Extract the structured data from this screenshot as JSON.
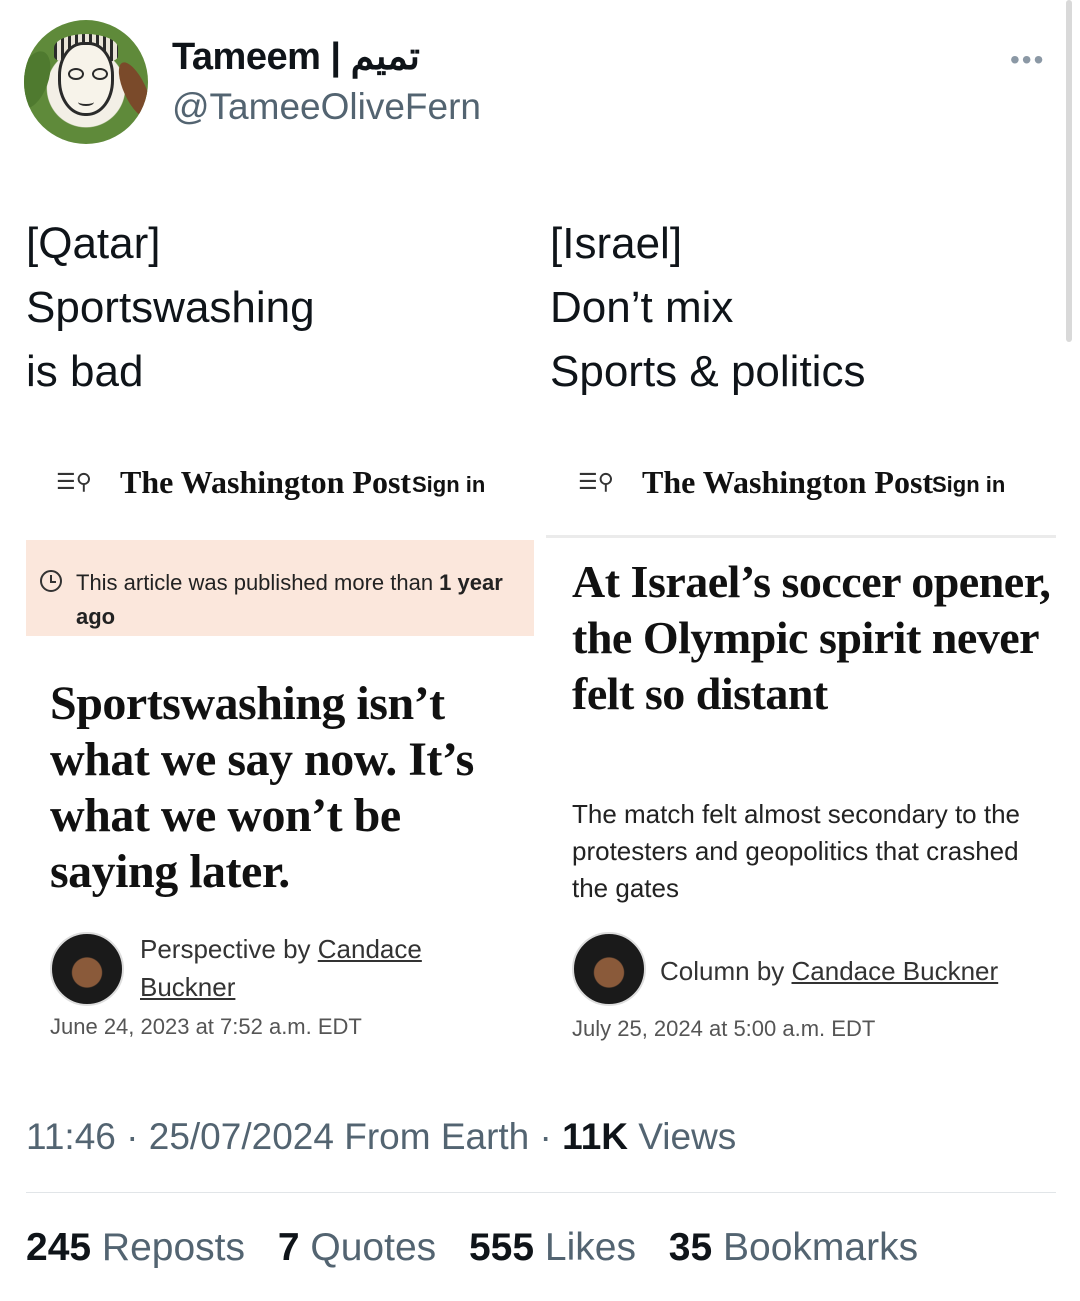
{
  "header": {
    "display_name": "Tameem | تميم",
    "handle": "@TameeOliveFern",
    "more_label": "•••"
  },
  "tweet": {
    "left_lines": [
      "[Qatar]",
      "Sportswashing",
      "is bad"
    ],
    "right_lines": [
      "[Israel]",
      "Don’t mix",
      "Sports & politics"
    ]
  },
  "left_article": {
    "menu_icon": "menu-search-icon",
    "masthead": "The Washington Post",
    "signin": "Sign in",
    "notice_text": "This article was published more than ",
    "notice_bold": "1 year ago",
    "headline": "Sportswashing isn’t what we say now. It’s what we won’t be saying later.",
    "byline_prefix": "Perspective by ",
    "author": "Candace Buckner",
    "date": "June 24, 2023 at 7:52 a.m. EDT"
  },
  "right_article": {
    "menu_icon": "menu-search-icon",
    "masthead": "The Washington Post",
    "signin": "Sign in",
    "headline": "At Israel’s soccer opener, the Olympic spirit never felt so distant",
    "dek": "The match felt almost secondary to the protesters and geopolitics that crashed the gates",
    "byline_prefix": "Column by ",
    "author": "Candace Buckner",
    "date": "July 25, 2024 at 5:00 a.m. EDT"
  },
  "meta": {
    "time": "11:46",
    "date": "25/07/2024",
    "source": "From Earth",
    "views_count": "11K",
    "views_label": "Views"
  },
  "stats": {
    "reposts_count": "245",
    "reposts_label": "Reposts",
    "quotes_count": "7",
    "quotes_label": "Quotes",
    "likes_count": "555",
    "likes_label": "Likes",
    "bookmarks_count": "35",
    "bookmarks_label": "Bookmarks"
  }
}
